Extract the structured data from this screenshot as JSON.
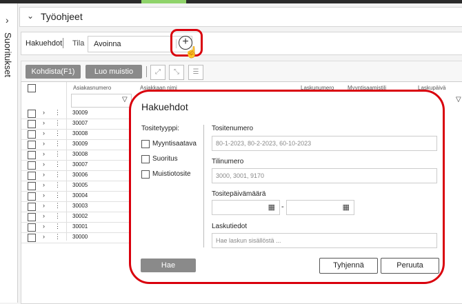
{
  "sidebar": {
    "label": "Suoritukset",
    "chevron": "›"
  },
  "header": {
    "title": "Työohjeet",
    "caret": "⌄"
  },
  "filter": {
    "label": "Hakuehdot",
    "state_label": "Tila",
    "state_value": "Avoinna",
    "chevron": "⌄",
    "add_icon": "+"
  },
  "toolbar": {
    "allocate_label": "Kohdista(F1)",
    "reminder_label": "Luo muistio",
    "icons": [
      "expand-icon",
      "collapse-icon",
      "settings-sliders-icon"
    ]
  },
  "table": {
    "columns": [
      "Asiakasnumero",
      "Asiakkaan nimi",
      "Laskunumero",
      "Myyntisaamistili",
      "Laskupäivä"
    ],
    "rows": [
      "30009",
      "30007",
      "30008",
      "30009",
      "30008",
      "30007",
      "30006",
      "30005",
      "30004",
      "30003",
      "30002",
      "30001",
      "30000"
    ]
  },
  "dialog": {
    "title": "Hakuehdot",
    "type_label": "Tositetyyppi:",
    "types": [
      "Myyntisaatava",
      "Suoritus",
      "Muistiotosite"
    ],
    "voucher_number_label": "Tositenumero",
    "voucher_number_placeholder": "80-1-2023, 80-2-2023, 60-10-2023",
    "account_label": "Tilinumero",
    "account_placeholder": "3000, 3001, 9170",
    "date_label": "Tositepäivämäärä",
    "date_separator": "-",
    "invoice_label": "Laskutiedot",
    "invoice_placeholder": "Hae laskun sisällöstä ...",
    "search_button": "Hae",
    "clear_button": "Tyhjennä",
    "cancel_button": "Peruuta"
  },
  "colors": {
    "highlight": "#d9000c",
    "button_grey": "#8a8a8a"
  }
}
